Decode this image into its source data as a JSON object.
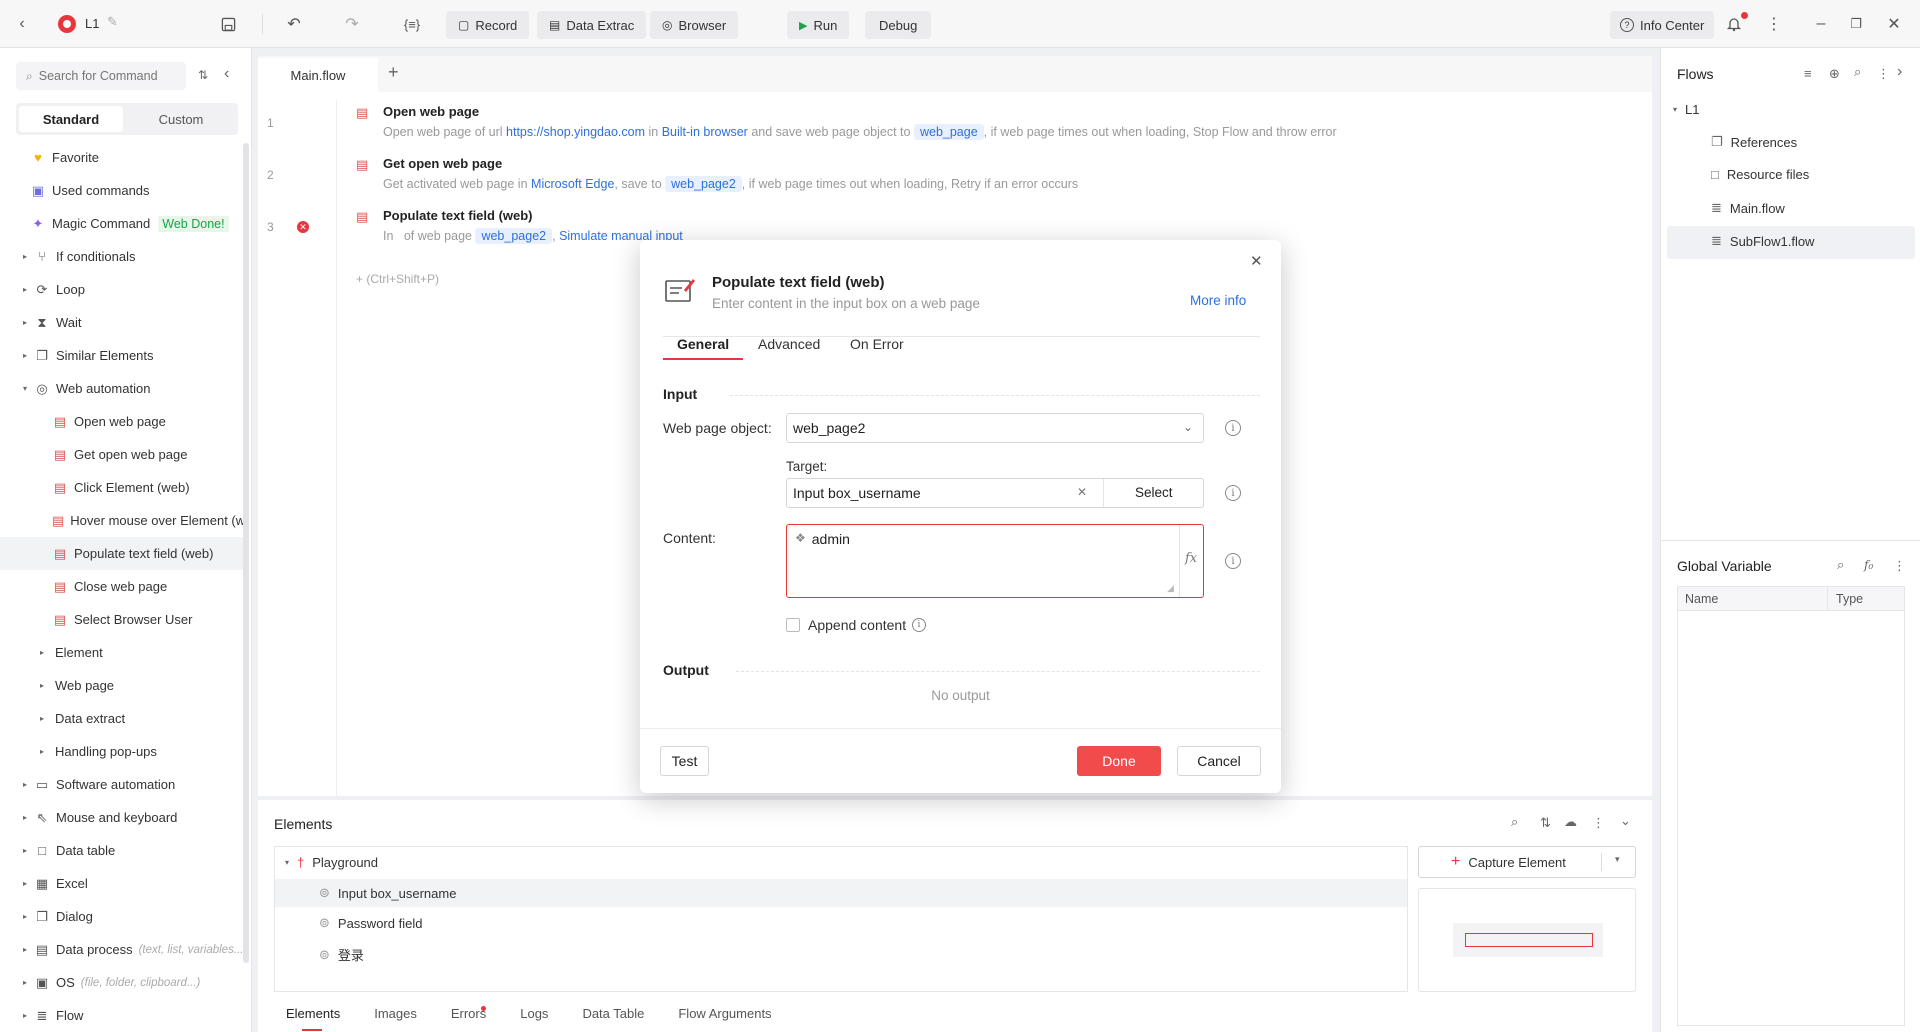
{
  "app": {
    "title": "L1"
  },
  "toolbar": {
    "record": "Record",
    "data_extract": "Data Extrac",
    "browser": "Browser",
    "run": "Run",
    "debug": "Debug",
    "info_center": "Info Center"
  },
  "sidebar": {
    "search_placeholder": "Search for Command",
    "tab_standard": "Standard",
    "tab_custom": "Custom",
    "favorite": "Favorite",
    "used": "Used commands",
    "magic": "Magic Command",
    "magic_badge": "Web Done!",
    "if": "If conditionals",
    "loop": "Loop",
    "wait": "Wait",
    "similar": "Similar Elements",
    "web_automation": "Web automation",
    "open_web": "Open web page",
    "get_open_web": "Get open web page",
    "click_el": "Click Element (web)",
    "hover": "Hover mouse over Element (w",
    "populate": "Populate text field (web)",
    "close_web": "Close web page",
    "select_user": "Select Browser User",
    "element": "Element",
    "web_page": "Web page",
    "data_extract": "Data extract",
    "popups": "Handling pop-ups",
    "software": "Software automation",
    "mouse": "Mouse and keyboard",
    "data_table": "Data table",
    "excel": "Excel",
    "dialog": "Dialog",
    "data_process": "Data process",
    "data_process_hint": "(text, list, variables...",
    "os": "OS",
    "os_hint": "(file, folder, clipboard...)",
    "flow": "Flow"
  },
  "editor": {
    "tab": "Main.flow",
    "steps": [
      {
        "num": "1",
        "title": "Open web page",
        "d1": "Open web page of url",
        "url": "https://shop.yingdao.com",
        "d2": "in",
        "browser": "Built-in browser",
        "d3": "and save web page object to",
        "var": "web_page",
        "d4": ", if web page times out when loading, Stop Flow and throw error"
      },
      {
        "num": "2",
        "title": "Get open web page",
        "d1": "Get activated web page in",
        "browser": "Microsoft Edge",
        "d2": ", save to",
        "var": "web_page2",
        "d3": ", if web page times out when loading, Retry if an error occurs"
      },
      {
        "num": "3",
        "title": "Populate text field (web)",
        "d1": "In",
        "d2": "of web page",
        "var": "web_page2",
        "d3": "Simulate manual input"
      }
    ],
    "add_hint": "+ (Ctrl+Shift+P)"
  },
  "flows": {
    "title": "Flows",
    "root": "L1",
    "items": [
      "References",
      "Resource files",
      "Main.flow",
      "SubFlow1.flow"
    ]
  },
  "global_var": {
    "title": "Global Variable",
    "col_name": "Name",
    "col_type": "Type"
  },
  "elements": {
    "title": "Elements",
    "group": "Playground",
    "items": [
      "Input box_username",
      "Password field",
      "登录"
    ],
    "capture": "Capture Element",
    "tabs": [
      "Elements",
      "Images",
      "Errors",
      "Logs",
      "Data Table",
      "Flow Arguments"
    ]
  },
  "modal": {
    "title": "Populate text field (web)",
    "subtitle": "Enter content in the input box on a web page",
    "more_info": "More info",
    "tabs": [
      "General",
      "Advanced",
      "On Error"
    ],
    "input_section": "Input",
    "web_page_label": "Web page object:",
    "web_page_value": "web_page2",
    "target_label": "Target:",
    "target_value": "Input box_username",
    "select": "Select",
    "content_label": "Content:",
    "content_value": "admin",
    "fx": "fx",
    "append": "Append content",
    "output_section": "Output",
    "no_output": "No output",
    "test": "Test",
    "done": "Done",
    "cancel": "Cancel"
  },
  "colors": {
    "accent": "#f24b4b",
    "link": "#2d6fe0",
    "highlight_bg": "#e8f0ff"
  }
}
